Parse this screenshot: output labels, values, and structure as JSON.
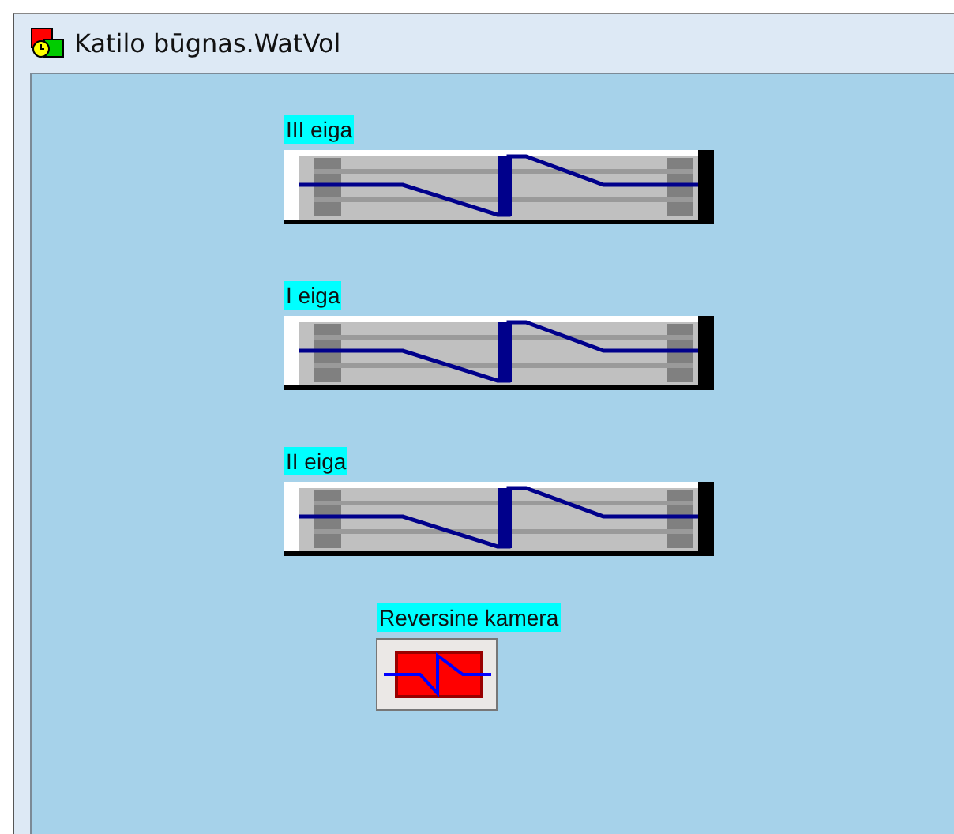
{
  "window": {
    "title": "Katilo būgnas.WatVol"
  },
  "drums": [
    {
      "label": "III eiga"
    },
    {
      "label": "I eiga"
    },
    {
      "label": "II eiga"
    }
  ],
  "reversing_chamber": {
    "label": "Reversine kamera"
  }
}
